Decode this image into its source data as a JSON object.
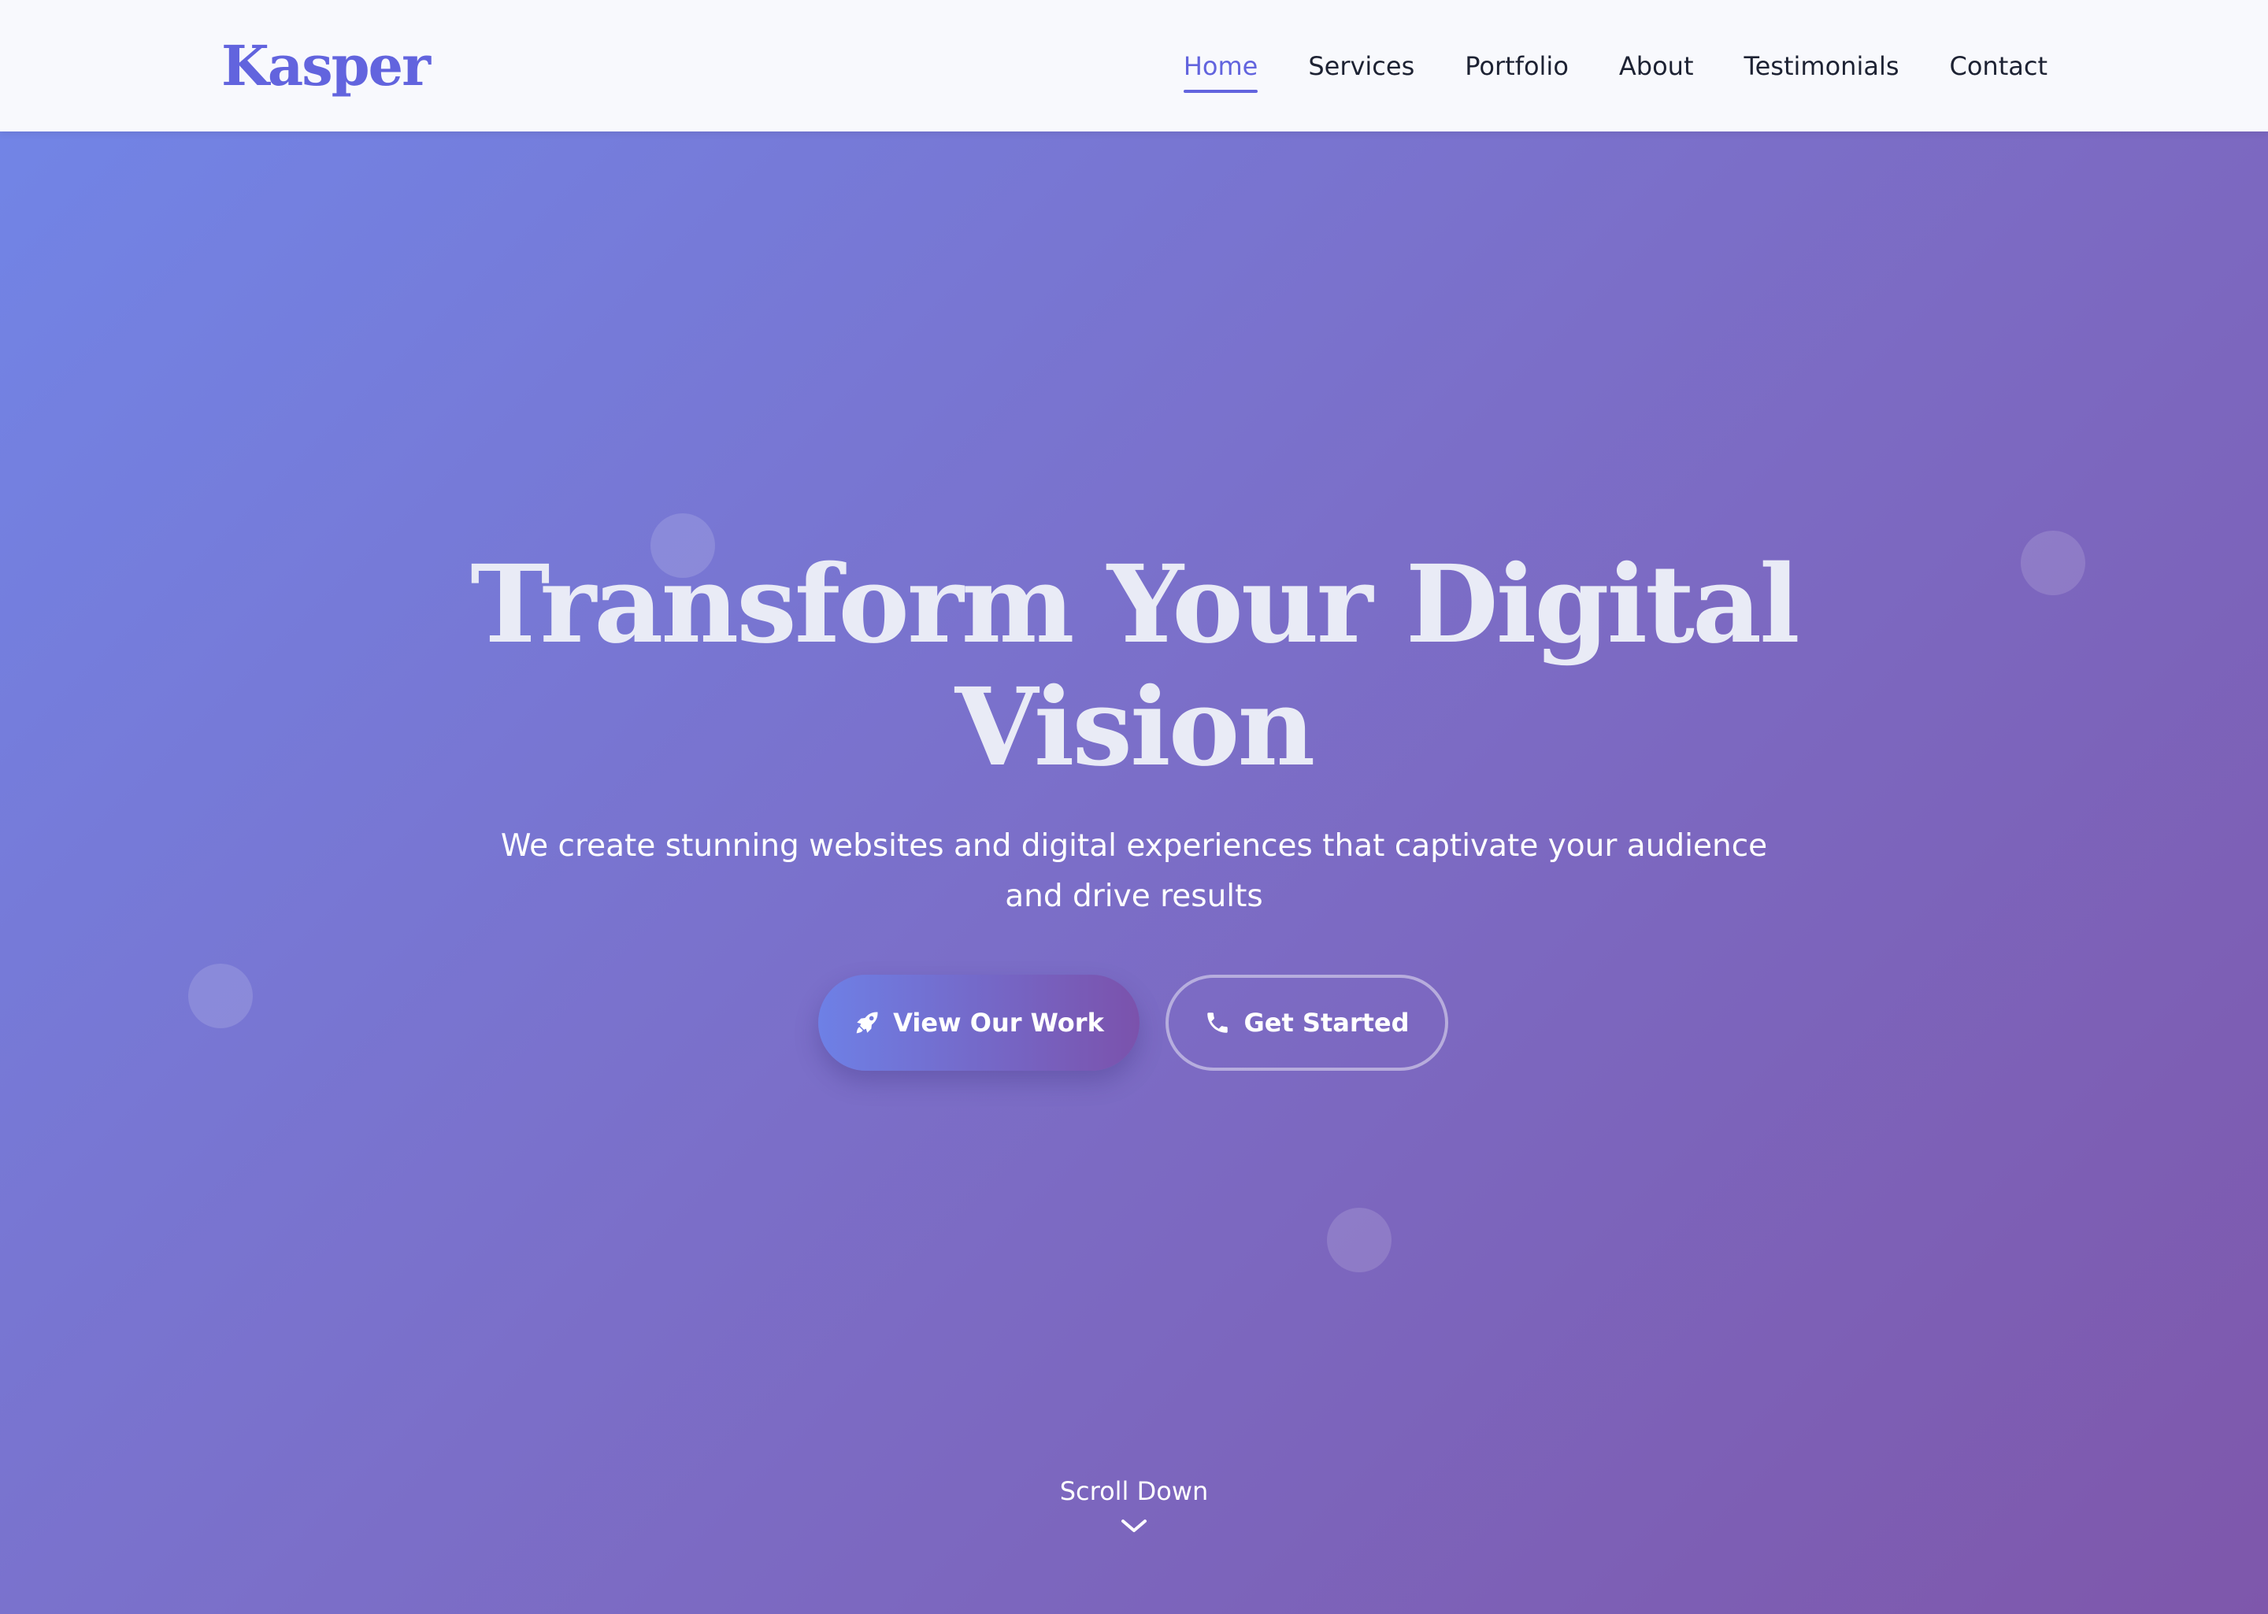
{
  "brand": {
    "name": "Kasper",
    "accent_color": "#6264de"
  },
  "nav": {
    "items": [
      {
        "label": "Home",
        "active": true
      },
      {
        "label": "Services",
        "active": false
      },
      {
        "label": "Portfolio",
        "active": false
      },
      {
        "label": "About",
        "active": false
      },
      {
        "label": "Testimonials",
        "active": false
      },
      {
        "label": "Contact",
        "active": false
      }
    ]
  },
  "hero": {
    "title_line1": "Transform Your Digital",
    "title_line2": "Vision",
    "subtitle_line1": "We create stunning websites and digital experiences that captivate your audience",
    "subtitle_line2": "and drive results",
    "primary_button": {
      "label": "View Our Work",
      "icon": "rocket-icon"
    },
    "secondary_button": {
      "label": "Get Started",
      "icon": "phone-icon"
    },
    "background_gradient": [
      "#7186e8",
      "#7e57ab"
    ]
  },
  "scroll": {
    "label": "Scroll Down",
    "icon": "chevron-down-icon"
  }
}
